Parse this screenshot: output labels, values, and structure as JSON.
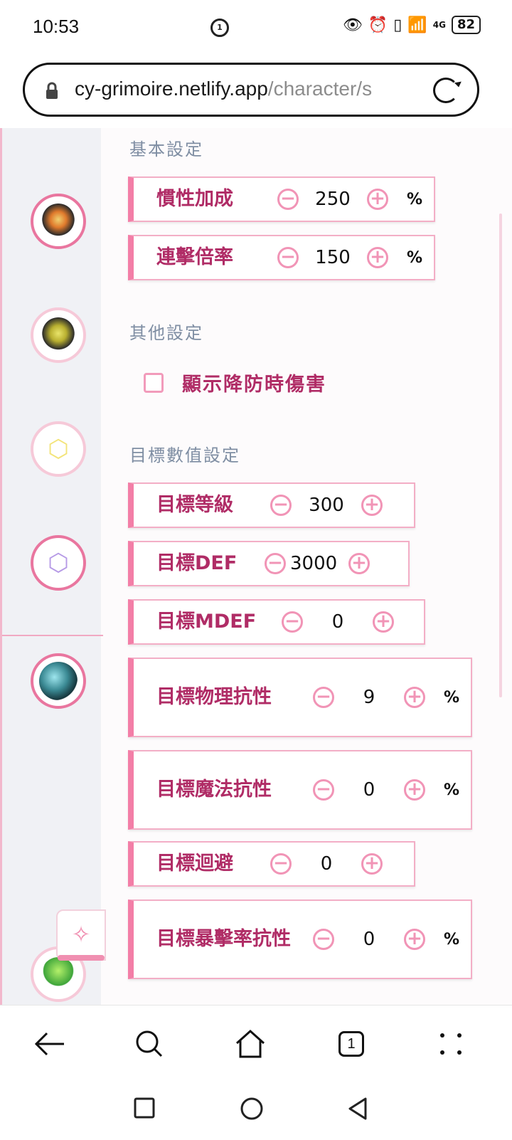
{
  "status_bar": {
    "time": "10:53",
    "center_badge": "1",
    "network": "4G",
    "wifi_badge": "6",
    "battery": "82"
  },
  "url_bar": {
    "host": "cy-grimoire.netlify.app",
    "path": "/character/s"
  },
  "sidebar": {
    "avatars": [
      {
        "name": "character-1",
        "active": true
      },
      {
        "name": "character-2",
        "active": false
      },
      {
        "name": "item-yellow",
        "active": false
      },
      {
        "name": "item-purple",
        "active": true
      },
      {
        "name": "character-wave",
        "active": true
      },
      {
        "name": "character-green",
        "active": false
      }
    ],
    "float_button_icon": "sparkle-icon"
  },
  "sections": {
    "basic": "基本設定",
    "other": "其他設定",
    "target": "目標數值設定"
  },
  "basic_fields": [
    {
      "label": "慣性加成",
      "value": "250",
      "unit": "%"
    },
    {
      "label": "連擊倍率",
      "value": "150",
      "unit": "%"
    }
  ],
  "other": {
    "show_def_down_damage": {
      "label": "顯示降防時傷害",
      "checked": false
    }
  },
  "target_fields": [
    {
      "label": "目標等級",
      "value": "300",
      "unit": ""
    },
    {
      "label": "目標DEF",
      "value": "3000",
      "unit": ""
    },
    {
      "label": "目標MDEF",
      "value": "0",
      "unit": ""
    },
    {
      "label": "目標物理抗性",
      "value": "9",
      "unit": "%"
    },
    {
      "label": "目標魔法抗性",
      "value": "0",
      "unit": "%"
    },
    {
      "label": "目標迴避",
      "value": "0",
      "unit": ""
    },
    {
      "label": "目標暴擊率抗性",
      "value": "0",
      "unit": "%"
    }
  ],
  "buttons": {
    "minus": "−",
    "plus": "+"
  },
  "browser_nav": {
    "tab_count": "1"
  },
  "colors": {
    "accent": "#f37ea7",
    "label": "#b02c66",
    "section": "#7f8ea3"
  }
}
